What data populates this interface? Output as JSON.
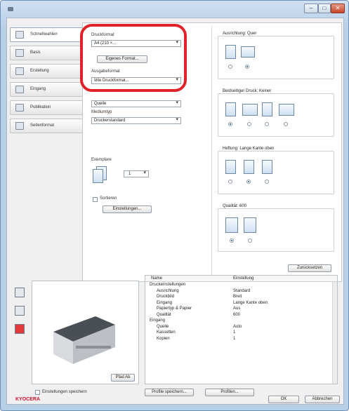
{
  "window": {
    "controls": [
      "–",
      "□",
      "✕"
    ]
  },
  "sidebar": {
    "items": [
      {
        "label": "Schnellwahlen",
        "icon": "quick-print-icon"
      },
      {
        "label": "Basis",
        "icon": "basic-icon"
      },
      {
        "label": "Erstellung",
        "icon": "layout-icon"
      },
      {
        "label": "Eingang",
        "icon": "input-tray-icon"
      },
      {
        "label": "Publikation",
        "icon": "publishing-icon"
      },
      {
        "label": "Seitenformat",
        "icon": "page-format-icon"
      }
    ]
  },
  "main": {
    "druckformat_label": "Druckformat",
    "druckformat_value": "A4 (210 ×...",
    "eigene_button": "Eigenes Format...",
    "ausgabeformat_label": "Ausgabeformat",
    "ausgabeformat_value": "Wie Druckformat...",
    "quelle_value": "Quelle",
    "medientyp_label": "Mediumtyp",
    "medientyp_value": "Druckerstandard",
    "exemplare_label": "Exemplare",
    "exemplare_value": "1",
    "sortieren_label": "Sortieren",
    "sortieren_button": "Einstellungen...",
    "reset_button": "Zurücksetzen"
  },
  "right": {
    "ausrichtung_title": "Ausrichtung: Quer",
    "duplex_title": "Beidseitiger Druck: Keiner",
    "bindung_title": "Heftung: Lange Kante oben",
    "qualitaet_title": "Qualität: 600"
  },
  "table": {
    "headers": [
      "Name",
      "Einstellung"
    ],
    "rows": [
      [
        "Druckeinstellungen",
        ""
      ],
      [
        "Ausrichtung",
        "Standard"
      ],
      [
        "Druckbild",
        "Breit"
      ],
      [
        "Eingang",
        "Lange Kante oben"
      ],
      [
        "Papiertyp & Papier",
        "Aus"
      ],
      [
        "Qualität",
        "600"
      ],
      [
        "Eingang",
        ""
      ],
      [
        "Quelle",
        "Auto"
      ],
      [
        "Kassetten",
        "1"
      ],
      [
        "Kopien",
        "1"
      ]
    ]
  },
  "preview": {
    "button": "Pfad Ab"
  },
  "footer": {
    "checkbox_label": "Einstellungen speichern",
    "profile_button": "Profile speichern...",
    "profiles_button": "Profilen...",
    "ok": "OK",
    "cancel": "Abbrechen"
  },
  "brand": {
    "logo_text": "KYOCERA",
    "color": "#c8102e"
  }
}
